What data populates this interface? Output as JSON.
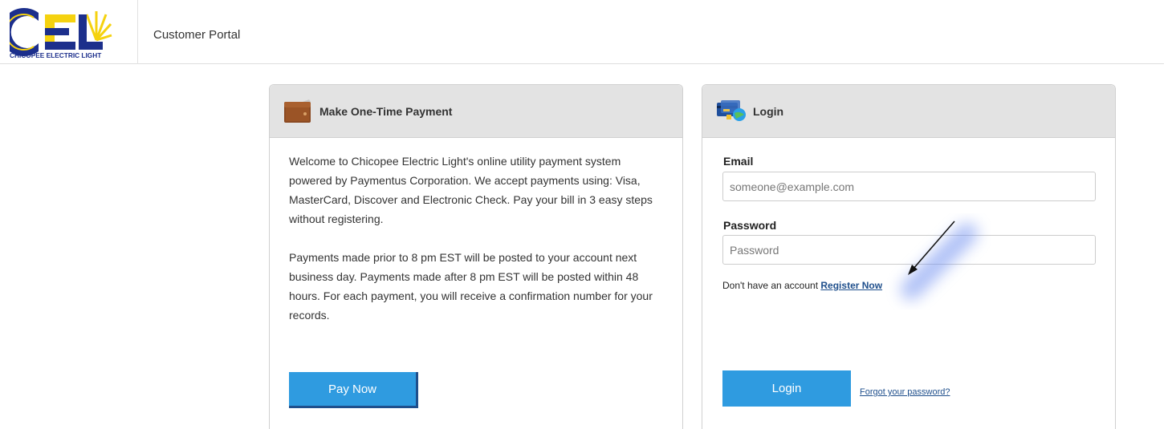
{
  "header": {
    "logo_text": "CHICOPEE ELECTRIC LIGHT",
    "logo_letters": "CEL",
    "portal_title": "Customer Portal"
  },
  "payment_panel": {
    "title": "Make One-Time Payment",
    "icon": "wallet-icon",
    "paragraph_1": "Welcome to Chicopee Electric Light's online utility payment system powered by Paymentus Corporation. We accept payments using: Visa, MasterCard, Discover and Electronic Check. Pay your bill in 3 easy steps without registering.",
    "paragraph_2": "Payments made prior to 8 pm EST will be posted to your account next business day. Payments made after 8 pm EST will be posted within 48 hours. For each payment, you will receive a confirmation number for your records.",
    "pay_button": "Pay Now"
  },
  "login_panel": {
    "title": "Login",
    "icon": "credit-card-globe-icon",
    "email_label": "Email",
    "email_placeholder": "someone@example.com",
    "email_value": "",
    "password_label": "Password",
    "password_placeholder": "Password",
    "password_value": "",
    "register_prompt": "Don't have an account",
    "register_link": "Register Now",
    "login_button": "Login",
    "forgot_link": "Forgot your password?"
  },
  "colors": {
    "accent_button": "#2f9be0",
    "link": "#1f4f8c",
    "panel_heading_bg": "#e3e3e3",
    "logo_blue": "#1c2f8c",
    "logo_yellow": "#f5d20f"
  }
}
